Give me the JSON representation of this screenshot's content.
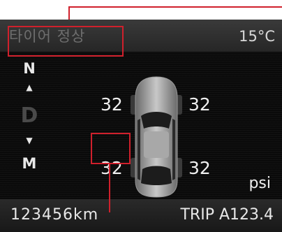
{
  "display": {
    "status_text": "타이어 정상",
    "outside_temp": "15°C",
    "gear_indicator": {
      "top": "N",
      "up_arrow": "▲",
      "current": "D",
      "down_arrow": "▼",
      "bottom": "M"
    },
    "tire_pressure": {
      "front_left": "32",
      "front_right": "32",
      "rear_left": "32",
      "rear_right": "32",
      "unit": "psi"
    },
    "odometer": "123456km",
    "trip": "TRIP A123.4"
  },
  "icons": {
    "car": "car-top-view-icon"
  },
  "colors": {
    "callout": "#d0202c",
    "screen_bg": "#0a0a0a",
    "status_text": "#6e6e6e",
    "text": "#f0f0f0"
  }
}
